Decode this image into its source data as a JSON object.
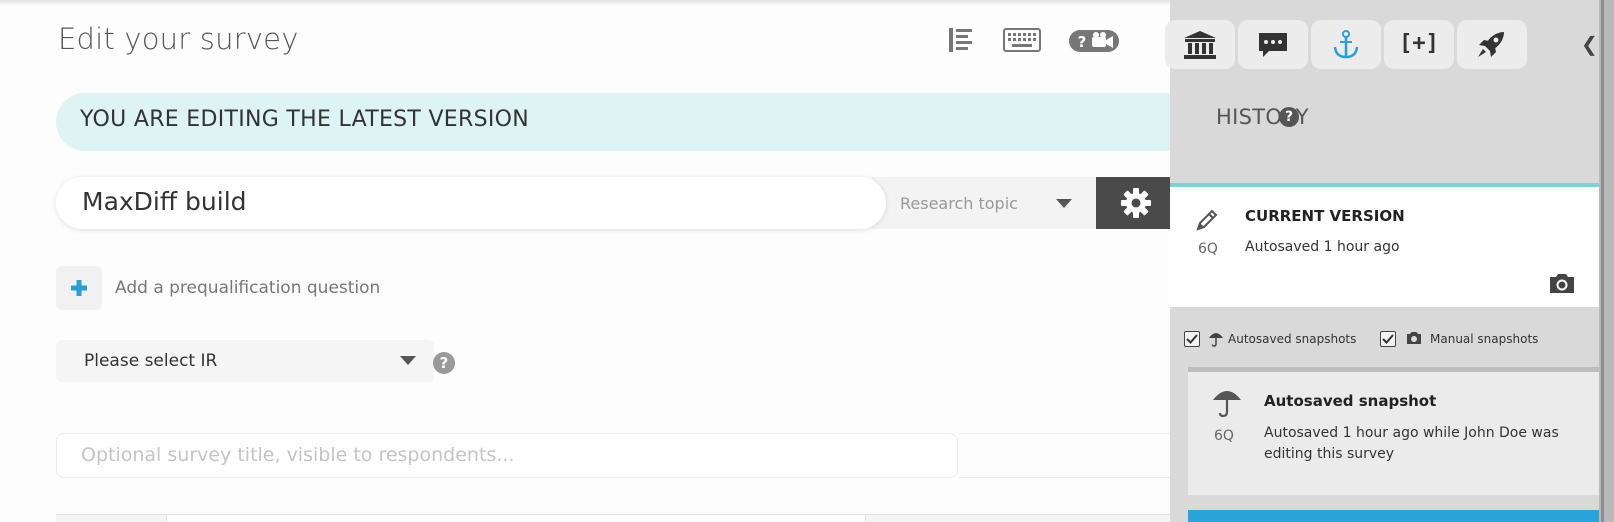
{
  "main": {
    "title": "Edit your survey",
    "toolbar": {
      "outline_icon": "list-outline-icon",
      "keyboard_icon": "keyboard-icon",
      "help_video_icon": "help-video-icon"
    },
    "banner": "YOU ARE EDITING THE LATEST VERSION",
    "survey_name": "MaxDiff build",
    "research_topic": {
      "placeholder": "Research topic"
    },
    "prequalification": {
      "label": "Add a prequalification question"
    },
    "ir_select": {
      "value": "Please select IR"
    },
    "survey_title": {
      "placeholder": "Optional survey title, visible to respondents..."
    }
  },
  "panel": {
    "tabs": [
      {
        "icon": "bank-icon"
      },
      {
        "icon": "comment-icon"
      },
      {
        "icon": "anchor-icon"
      },
      {
        "text": "[+]"
      },
      {
        "icon": "rocket-icon"
      }
    ],
    "history_title": "HISTORY",
    "current": {
      "title": "CURRENT VERSION",
      "status": "Autosaved 1 hour ago",
      "count": "6Q"
    },
    "filters": {
      "autosaved": {
        "label": "Autosaved snapshots",
        "checked": true
      },
      "manual": {
        "label": "Manual snapshots",
        "checked": true
      }
    },
    "snapshot": {
      "title": "Autosaved snapshot",
      "status": "Autosaved 1 hour ago while John Doe was editing this survey",
      "count": "6Q"
    }
  },
  "colors": {
    "banner_bg": "#ddf3f4",
    "current_accent": "#7fd2d5",
    "next_card_accent": "#2aa3d8",
    "plus_icon": "#2a9fd6"
  }
}
